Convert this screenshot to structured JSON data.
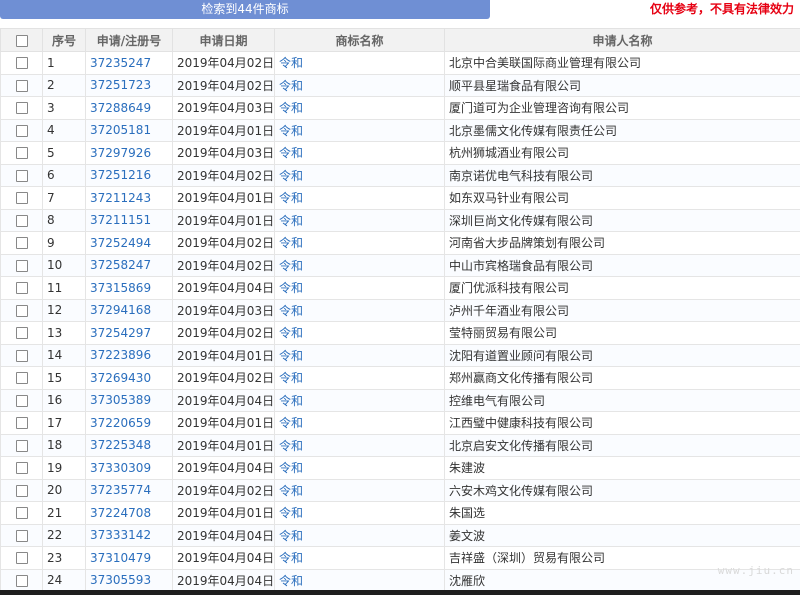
{
  "search_button_label": "检索到44件商标",
  "disclaimer": "仅供参考，不具有法律效力",
  "columns": {
    "seq": "序号",
    "reg_no": "申请/注册号",
    "date": "申请日期",
    "mark": "商标名称",
    "applicant": "申请人名称"
  },
  "rows": [
    {
      "seq": "1",
      "reg": "37235247",
      "date": "2019年04月02日",
      "mark": "令和",
      "applicant": "北京中合美联国际商业管理有限公司"
    },
    {
      "seq": "2",
      "reg": "37251723",
      "date": "2019年04月02日",
      "mark": "令和",
      "applicant": "顺平县星瑞食品有限公司"
    },
    {
      "seq": "3",
      "reg": "37288649",
      "date": "2019年04月03日",
      "mark": "令和",
      "applicant": "厦门道可为企业管理咨询有限公司"
    },
    {
      "seq": "4",
      "reg": "37205181",
      "date": "2019年04月01日",
      "mark": "令和",
      "applicant": "北京墨儒文化传媒有限责任公司"
    },
    {
      "seq": "5",
      "reg": "37297926",
      "date": "2019年04月03日",
      "mark": "令和",
      "applicant": "杭州狮城酒业有限公司"
    },
    {
      "seq": "6",
      "reg": "37251216",
      "date": "2019年04月02日",
      "mark": "令和",
      "applicant": "南京诺优电气科技有限公司"
    },
    {
      "seq": "7",
      "reg": "37211243",
      "date": "2019年04月01日",
      "mark": "令和",
      "applicant": "如东双马针业有限公司"
    },
    {
      "seq": "8",
      "reg": "37211151",
      "date": "2019年04月01日",
      "mark": "令和",
      "applicant": "深圳巨尚文化传媒有限公司"
    },
    {
      "seq": "9",
      "reg": "37252494",
      "date": "2019年04月02日",
      "mark": "令和",
      "applicant": "河南省大步品牌策划有限公司"
    },
    {
      "seq": "10",
      "reg": "37258247",
      "date": "2019年04月02日",
      "mark": "令和",
      "applicant": "中山市宾格瑞食品有限公司"
    },
    {
      "seq": "11",
      "reg": "37315869",
      "date": "2019年04月04日",
      "mark": "令和",
      "applicant": "厦门优派科技有限公司"
    },
    {
      "seq": "12",
      "reg": "37294168",
      "date": "2019年04月03日",
      "mark": "令和",
      "applicant": "泸州千年酒业有限公司"
    },
    {
      "seq": "13",
      "reg": "37254297",
      "date": "2019年04月02日",
      "mark": "令和",
      "applicant": "莹特丽贸易有限公司"
    },
    {
      "seq": "14",
      "reg": "37223896",
      "date": "2019年04月01日",
      "mark": "令和",
      "applicant": "沈阳有道置业顾问有限公司"
    },
    {
      "seq": "15",
      "reg": "37269430",
      "date": "2019年04月02日",
      "mark": "令和",
      "applicant": "郑州赢商文化传播有限公司"
    },
    {
      "seq": "16",
      "reg": "37305389",
      "date": "2019年04月04日",
      "mark": "令和",
      "applicant": "控维电气有限公司"
    },
    {
      "seq": "17",
      "reg": "37220659",
      "date": "2019年04月01日",
      "mark": "令和",
      "applicant": "江西璧中健康科技有限公司"
    },
    {
      "seq": "18",
      "reg": "37225348",
      "date": "2019年04月01日",
      "mark": "令和",
      "applicant": "北京启安文化传播有限公司"
    },
    {
      "seq": "19",
      "reg": "37330309",
      "date": "2019年04月04日",
      "mark": "令和",
      "applicant": "朱建波"
    },
    {
      "seq": "20",
      "reg": "37235774",
      "date": "2019年04月02日",
      "mark": "令和",
      "applicant": "六安木鸡文化传媒有限公司"
    },
    {
      "seq": "21",
      "reg": "37224708",
      "date": "2019年04月01日",
      "mark": "令和",
      "applicant": "朱国选"
    },
    {
      "seq": "22",
      "reg": "37333142",
      "date": "2019年04月04日",
      "mark": "令和",
      "applicant": "姜文波"
    },
    {
      "seq": "23",
      "reg": "37310479",
      "date": "2019年04月04日",
      "mark": "令和",
      "applicant": "吉祥盛（深圳）贸易有限公司"
    },
    {
      "seq": "24",
      "reg": "37305593",
      "date": "2019年04月04日",
      "mark": "令和",
      "applicant": "沈雁欣"
    }
  ],
  "watermark": "www.jiu.cn",
  "colors": {
    "header_button": "#6f8fd4",
    "disclaimer": "#e60012",
    "link": "#2a6ebd"
  }
}
